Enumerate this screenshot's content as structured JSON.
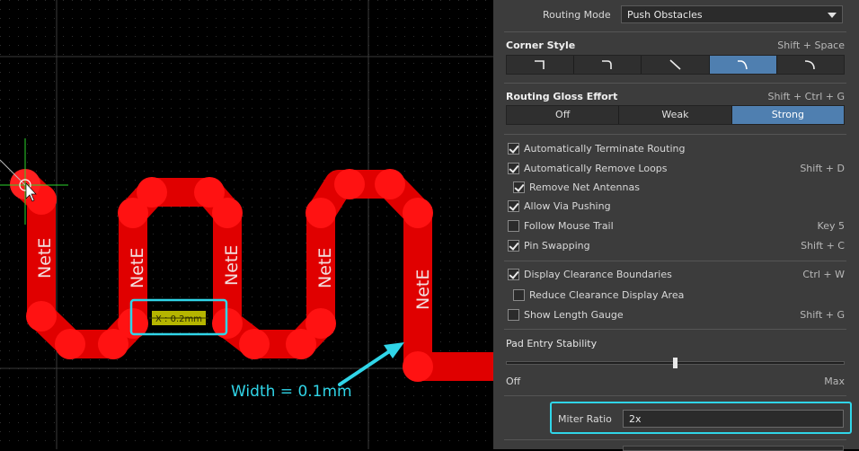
{
  "canvas": {
    "net_labels": [
      "NetE",
      "NetE",
      "NetE",
      "NetE",
      "NetE"
    ],
    "measure_label": "X : 0.2mm",
    "annotation": "Width = 0.1mm",
    "colors": {
      "trace": "#e00000",
      "pad": "#ff1a1a",
      "highlight": "#30d5e8",
      "background": "#000000",
      "grid": "#2a2a2a"
    },
    "icons": {
      "crosshair": "crosshair-cursor-icon",
      "pointer": "mouse-pointer-icon"
    }
  },
  "panel": {
    "routing_mode": {
      "label": "Routing Mode",
      "value": "Push Obstacles"
    },
    "corner_style": {
      "label": "Corner Style",
      "shortcut": "Shift + Space",
      "options": [
        "corner-90-icon",
        "corner-90-arc-icon",
        "corner-45-icon",
        "corner-45-arc-icon",
        "corner-any-arc-icon"
      ],
      "selected": "corner-45-arc-icon"
    },
    "gloss_effort": {
      "label": "Routing Gloss Effort",
      "shortcut": "Shift + Ctrl + G",
      "options": [
        "Off",
        "Weak",
        "Strong"
      ],
      "selected": "Strong"
    },
    "options": [
      {
        "label": "Automatically Terminate Routing",
        "checked": true,
        "shortcut": ""
      },
      {
        "label": "Automatically Remove Loops",
        "checked": true,
        "shortcut": "Shift + D"
      },
      {
        "label": "Remove Net Antennas",
        "checked": true,
        "shortcut": ""
      },
      {
        "label": "Allow Via Pushing",
        "checked": true,
        "shortcut": ""
      },
      {
        "label": "Follow Mouse Trail",
        "checked": false,
        "shortcut": "Key 5"
      },
      {
        "label": "Pin Swapping",
        "checked": true,
        "shortcut": "Shift + C"
      }
    ],
    "display_options": [
      {
        "label": "Display Clearance Boundaries",
        "checked": true,
        "shortcut": "Ctrl + W"
      },
      {
        "label": "Reduce Clearance Display Area",
        "checked": false,
        "shortcut": ""
      },
      {
        "label": "Show Length Gauge",
        "checked": false,
        "shortcut": "Shift + G"
      }
    ],
    "pad_entry": {
      "label": "Pad Entry Stability",
      "min_label": "Off",
      "max_label": "Max",
      "value_fraction": 0.5
    },
    "miter_ratio": {
      "label": "Miter Ratio",
      "value": "2x"
    }
  }
}
